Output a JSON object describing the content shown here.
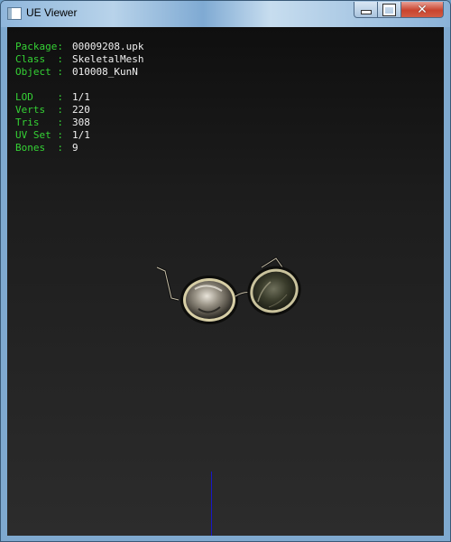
{
  "window": {
    "title": "UE Viewer",
    "close_glyph": "✕",
    "icons": {
      "app": "app-window-icon",
      "minimize": "minimize-icon",
      "maximize": "maximize-icon",
      "close": "close-icon"
    }
  },
  "info": {
    "package": {
      "label": "Package:",
      "value": "00009208.upk"
    },
    "class": {
      "label": "Class  :",
      "value": "SkeletalMesh"
    },
    "object": {
      "label": "Object :",
      "value": "010008_KunN"
    },
    "lod": {
      "label": "LOD    :",
      "value": "1/1"
    },
    "verts": {
      "label": "Verts  :",
      "value": "220"
    },
    "tris": {
      "label": "Tris   :",
      "value": "308"
    },
    "uvset": {
      "label": "UV Set :",
      "value": "1/1"
    },
    "bones": {
      "label": "Bones  :",
      "value": "9"
    }
  },
  "colors": {
    "label": "#35d235",
    "value": "#f0f0f0",
    "axis": "#1717c8",
    "background_top": "#0f0f0f",
    "background_bottom": "#2c2c2c"
  }
}
